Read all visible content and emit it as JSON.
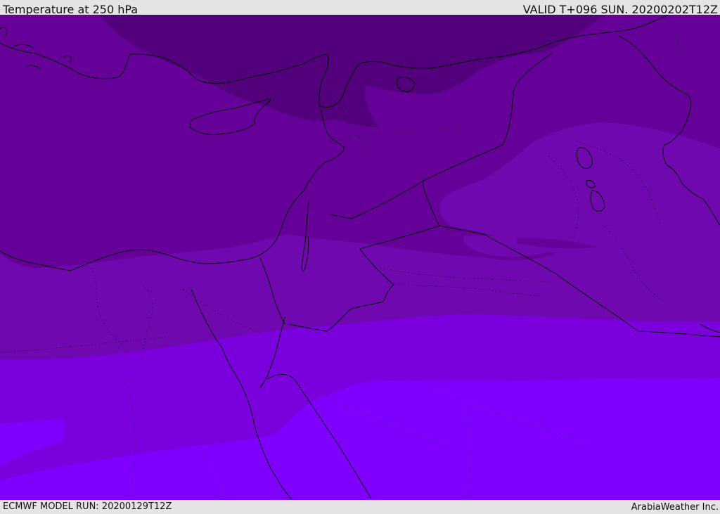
{
  "header": {
    "title": "Temperature at 250 hPa",
    "valid_time": "VALID T+096 SUN. 20200202T12Z"
  },
  "footer": {
    "model_run": "ECMWF MODEL RUN: 20200129T12Z",
    "credit": "ArabiaWeather Inc."
  },
  "colors": {
    "band_coldest": "#53007c",
    "band_cold": "#650098",
    "band_mid": "#7008b0",
    "band_warm": "#7b00de",
    "band_warmest": "#8000ff",
    "coastline": "#000000"
  }
}
